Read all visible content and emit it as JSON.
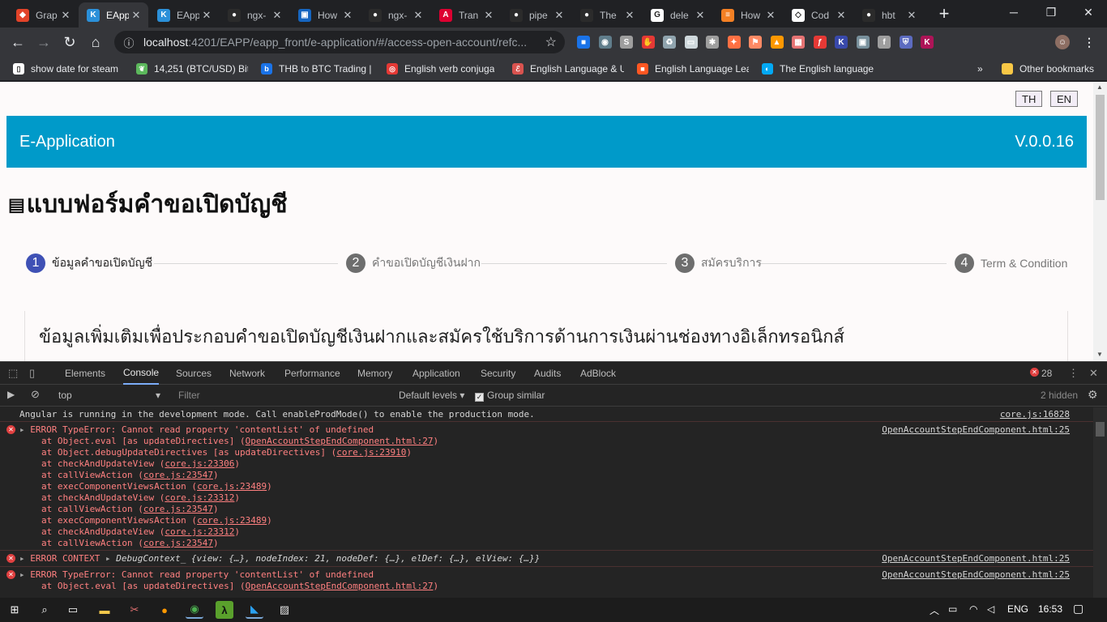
{
  "browser": {
    "tabs": [
      {
        "title": "Grap",
        "icon": "gitlab-icon",
        "color": "#e24329",
        "glyph": "◆",
        "active": false
      },
      {
        "title": "EApp",
        "icon": "eapp-icon",
        "color": "#2b90d9",
        "glyph": "K",
        "active": true
      },
      {
        "title": "EApp",
        "icon": "eapp-icon",
        "color": "#2b90d9",
        "glyph": "K",
        "active": false
      },
      {
        "title": "ngx-",
        "icon": "github-icon",
        "color": "#2b2b2b",
        "glyph": "●",
        "active": false
      },
      {
        "title": "How",
        "icon": "trello-icon",
        "color": "#1565c0",
        "glyph": "▣",
        "active": false
      },
      {
        "title": "ngx-",
        "icon": "github-icon",
        "color": "#2b2b2b",
        "glyph": "●",
        "active": false
      },
      {
        "title": "Tran",
        "icon": "angular-icon",
        "color": "#dd0031",
        "glyph": "A",
        "active": false
      },
      {
        "title": "pipe",
        "icon": "github-icon",
        "color": "#2b2b2b",
        "glyph": "●",
        "active": false
      },
      {
        "title": "The",
        "icon": "github-icon",
        "color": "#2b2b2b",
        "glyph": "●",
        "active": false
      },
      {
        "title": "dele",
        "icon": "google-icon",
        "color": "#ffffff",
        "glyph": "G",
        "active": false
      },
      {
        "title": "How",
        "icon": "stackoverflow-icon",
        "color": "#f48024",
        "glyph": "≡",
        "active": false
      },
      {
        "title": "Cod",
        "icon": "codepen-icon",
        "color": "#ffffff",
        "glyph": "◇",
        "active": false
      },
      {
        "title": "hbt",
        "icon": "github-icon",
        "color": "#2b2b2b",
        "glyph": "●",
        "active": false
      }
    ],
    "url_host": "localhost",
    "url_path": ":4201/EAPP/eapp_front/e-application/#/access-open-account/refc...",
    "bookmarks": [
      {
        "label": "show date for steam",
        "icon": "page-icon",
        "color": "#ffffff",
        "glyph": "▯"
      },
      {
        "label": "14,251 (BTC/USD) Bit",
        "icon": "leaf-icon",
        "color": "#5cb85c",
        "glyph": "❦"
      },
      {
        "label": "THB to BTC Trading |",
        "icon": "bx-icon",
        "color": "#1a73e8",
        "glyph": "b"
      },
      {
        "label": "English verb conjuga",
        "icon": "reverso-icon",
        "color": "#e53935",
        "glyph": "◎"
      },
      {
        "label": "English Language & U",
        "icon": "stackexchange-icon",
        "color": "#d9534f",
        "glyph": "ℰ"
      },
      {
        "label": "English Language Lea",
        "icon": "bookmark-icon",
        "color": "#ff5722",
        "glyph": "■"
      },
      {
        "label": "The English language",
        "icon": "circle-icon",
        "color": "#03a9f4",
        "glyph": "◐"
      }
    ],
    "bookmarks_more": "»",
    "other_bookmarks": "Other bookmarks"
  },
  "page": {
    "lang_th": "TH",
    "lang_en": "EN",
    "app_title": "E-Application",
    "version": "V.0.0.16",
    "form_title": "แบบฟอร์มคำขอเปิดบัญชี",
    "steps": [
      {
        "num": "1",
        "label": "ข้อมูลคำขอเปิดบัญชี",
        "active": true
      },
      {
        "num": "2",
        "label": "คำขอเปิดบัญชีเงินฝาก",
        "active": false
      },
      {
        "num": "3",
        "label": "สมัครบริการ",
        "active": false
      },
      {
        "num": "4",
        "label": "Term & Condition",
        "active": false
      }
    ],
    "section_heading": "ข้อมูลเพิ่มเติมเพื่อประกอบคำขอเปิดบัญชีเงินฝากและสมัครใช้บริการด้านการเงินผ่านช่องทางอิเล็กทรอนิกส์"
  },
  "devtools": {
    "tabs": [
      "Elements",
      "Console",
      "Sources",
      "Network",
      "Performance",
      "Memory",
      "Application",
      "Security",
      "Audits",
      "AdBlock"
    ],
    "active_tab": "Console",
    "error_count": "28",
    "context": "top",
    "filter_placeholder": "Filter",
    "levels": "Default levels",
    "group_similar": "Group similar",
    "hidden": "2 hidden",
    "messages": {
      "info": {
        "text": "Angular is running in the development mode. Call enableProdMode() to enable the production mode.",
        "source": "core.js:16828"
      },
      "error1": {
        "text": "ERROR TypeError: Cannot read property 'contentList' of undefined",
        "source": "OpenAccountStepEndComponent.html:25"
      },
      "trace1": [
        {
          "pre": "at Object.eval [as updateDirectives] (",
          "link": "OpenAccountStepEndComponent.html:27",
          "post": ")"
        },
        {
          "pre": "at Object.debugUpdateDirectives [as updateDirectives] (",
          "link": "core.js:23910",
          "post": ")"
        },
        {
          "pre": "at checkAndUpdateView (",
          "link": "core.js:23306",
          "post": ")"
        },
        {
          "pre": "at callViewAction (",
          "link": "core.js:23547",
          "post": ")"
        },
        {
          "pre": "at execComponentViewsAction (",
          "link": "core.js:23489",
          "post": ")"
        },
        {
          "pre": "at checkAndUpdateView (",
          "link": "core.js:23312",
          "post": ")"
        },
        {
          "pre": "at callViewAction (",
          "link": "core.js:23547",
          "post": ")"
        },
        {
          "pre": "at execComponentViewsAction (",
          "link": "core.js:23489",
          "post": ")"
        },
        {
          "pre": "at checkAndUpdateView (",
          "link": "core.js:23312",
          "post": ")"
        },
        {
          "pre": "at callViewAction (",
          "link": "core.js:23547",
          "post": ")"
        }
      ],
      "context": {
        "label": "ERROR CONTEXT",
        "value": "DebugContext_ {view: {…}, nodeIndex: 21, nodeDef: {…}, elDef: {…}, elView: {…}}",
        "source": "OpenAccountStepEndComponent.html:25"
      },
      "error2": {
        "text": "ERROR TypeError: Cannot read property 'contentList' of undefined",
        "source": "OpenAccountStepEndComponent.html:25"
      },
      "trace2": [
        {
          "pre": "at Object.eval [as updateDirectives] (",
          "link": "OpenAccountStepEndComponent.html:27",
          "post": ")"
        }
      ]
    }
  },
  "taskbar": {
    "lang": "ENG",
    "time": "16:53"
  }
}
